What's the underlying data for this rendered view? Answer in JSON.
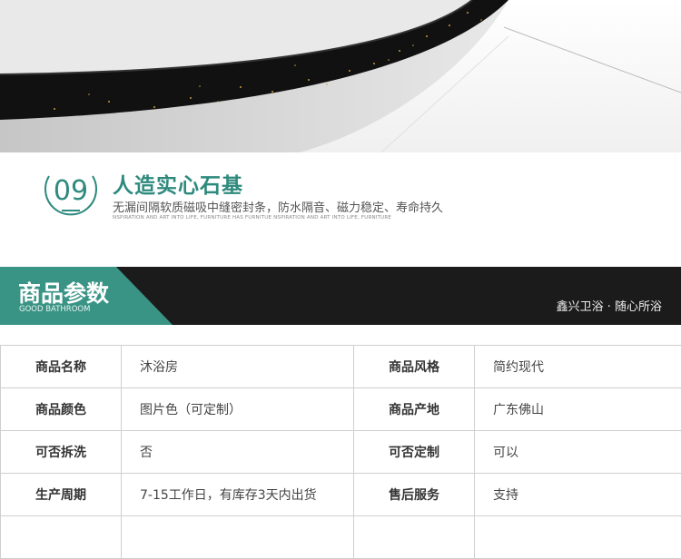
{
  "feature": {
    "number": "09",
    "title": "人造实心石基",
    "subtitle": "无漏间隔软质磁吸中缝密封条，防水隔音、磁力稳定、寿命持久",
    "tagline": "NSPIRATION AND ART INTO LIFE, FURNITURE HAS FURNITUE NSPIRATION AND ART INTO LIFE, FURNITURE"
  },
  "banner": {
    "title": "商品参数",
    "subtitle": "GOOD BATHROOM",
    "brand": "鑫兴卫浴 · 随心所浴"
  },
  "params": {
    "rows": [
      {
        "l1": "商品名称",
        "v1": "沐浴房",
        "l2": "商品风格",
        "v2": "简约现代"
      },
      {
        "l1": "商品颜色",
        "v1": "图片色（可定制）",
        "l2": "商品产地",
        "v2": "广东佛山"
      },
      {
        "l1": "可否拆洗",
        "v1": "否",
        "l2": "可否定制",
        "v2": "可以"
      },
      {
        "l1": "生产周期",
        "v1": "7-15工作日，有库存3天内出货",
        "l2": "售后服务",
        "v2": "支持"
      },
      {
        "l1": "",
        "v1": "",
        "l2": "",
        "v2": ""
      }
    ]
  },
  "colors": {
    "accent": "#2f8a7e",
    "banner_dark": "#1b1b1b",
    "banner_green": "#3a9485"
  }
}
